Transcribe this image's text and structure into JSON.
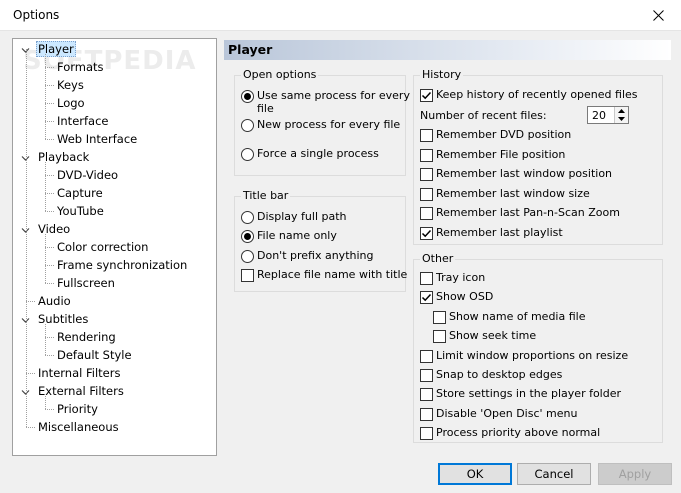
{
  "window": {
    "title": "Options"
  },
  "watermark": "SOFTPEDIA",
  "tree": [
    {
      "label": "Player",
      "level": 0,
      "expanded": true,
      "selected": true
    },
    {
      "label": "Formats",
      "level": 1
    },
    {
      "label": "Keys",
      "level": 1
    },
    {
      "label": "Logo",
      "level": 1
    },
    {
      "label": "Interface",
      "level": 1
    },
    {
      "label": "Web Interface",
      "level": 1
    },
    {
      "label": "Playback",
      "level": 0,
      "expanded": true
    },
    {
      "label": "DVD-Video",
      "level": 1
    },
    {
      "label": "Capture",
      "level": 1
    },
    {
      "label": "YouTube",
      "level": 1
    },
    {
      "label": "Video",
      "level": 0,
      "expanded": true
    },
    {
      "label": "Color correction",
      "level": 1
    },
    {
      "label": "Frame synchronization",
      "level": 1
    },
    {
      "label": "Fullscreen",
      "level": 1
    },
    {
      "label": "Audio",
      "level": 0
    },
    {
      "label": "Subtitles",
      "level": 0,
      "expanded": true
    },
    {
      "label": "Rendering",
      "level": 1
    },
    {
      "label": "Default Style",
      "level": 1
    },
    {
      "label": "Internal Filters",
      "level": 0
    },
    {
      "label": "External Filters",
      "level": 0,
      "expanded": true
    },
    {
      "label": "Priority",
      "level": 1
    },
    {
      "label": "Miscellaneous",
      "level": 0
    }
  ],
  "panel": {
    "title": "Player"
  },
  "open_options": {
    "title": "Open options",
    "items": [
      {
        "label": "Use same process for every",
        "label2": "file",
        "checked": true
      },
      {
        "label": "New process for every file",
        "checked": false
      },
      {
        "label": "Force a single process",
        "checked": false
      }
    ]
  },
  "title_bar": {
    "title": "Title bar",
    "radios": [
      {
        "label": "Display full path",
        "checked": false
      },
      {
        "label": "File name only",
        "checked": true
      },
      {
        "label": "Don't prefix anything",
        "checked": false
      }
    ],
    "replace": {
      "label": "Replace file name with title",
      "checked": false
    }
  },
  "history": {
    "title": "History",
    "keep": {
      "label": "Keep history of recently opened files",
      "checked": true
    },
    "recent_label": "Number of recent files:",
    "recent_value": "20",
    "items": [
      {
        "label": "Remember DVD position",
        "checked": false
      },
      {
        "label": "Remember File position",
        "checked": false
      },
      {
        "label": "Remember last window position",
        "checked": false
      },
      {
        "label": "Remember last window size",
        "checked": false
      },
      {
        "label": "Remember last Pan-n-Scan Zoom",
        "checked": false
      },
      {
        "label": "Remember last playlist",
        "checked": true
      }
    ]
  },
  "other": {
    "title": "Other",
    "items": [
      {
        "label": "Tray icon",
        "checked": false,
        "indent": false
      },
      {
        "label": "Show OSD",
        "checked": true,
        "indent": false
      },
      {
        "label": "Show name of media file",
        "checked": false,
        "indent": true
      },
      {
        "label": "Show seek time",
        "checked": false,
        "indent": true
      },
      {
        "label": "Limit window proportions on resize",
        "checked": false,
        "indent": false
      },
      {
        "label": "Snap to desktop edges",
        "checked": false,
        "indent": false
      },
      {
        "label": "Store settings in the player folder",
        "checked": false,
        "indent": false
      },
      {
        "label": "Disable 'Open Disc' menu",
        "checked": false,
        "indent": false
      },
      {
        "label": "Process priority above normal",
        "checked": false,
        "indent": false
      }
    ]
  },
  "buttons": {
    "ok": "OK",
    "cancel": "Cancel",
    "apply": "Apply"
  }
}
